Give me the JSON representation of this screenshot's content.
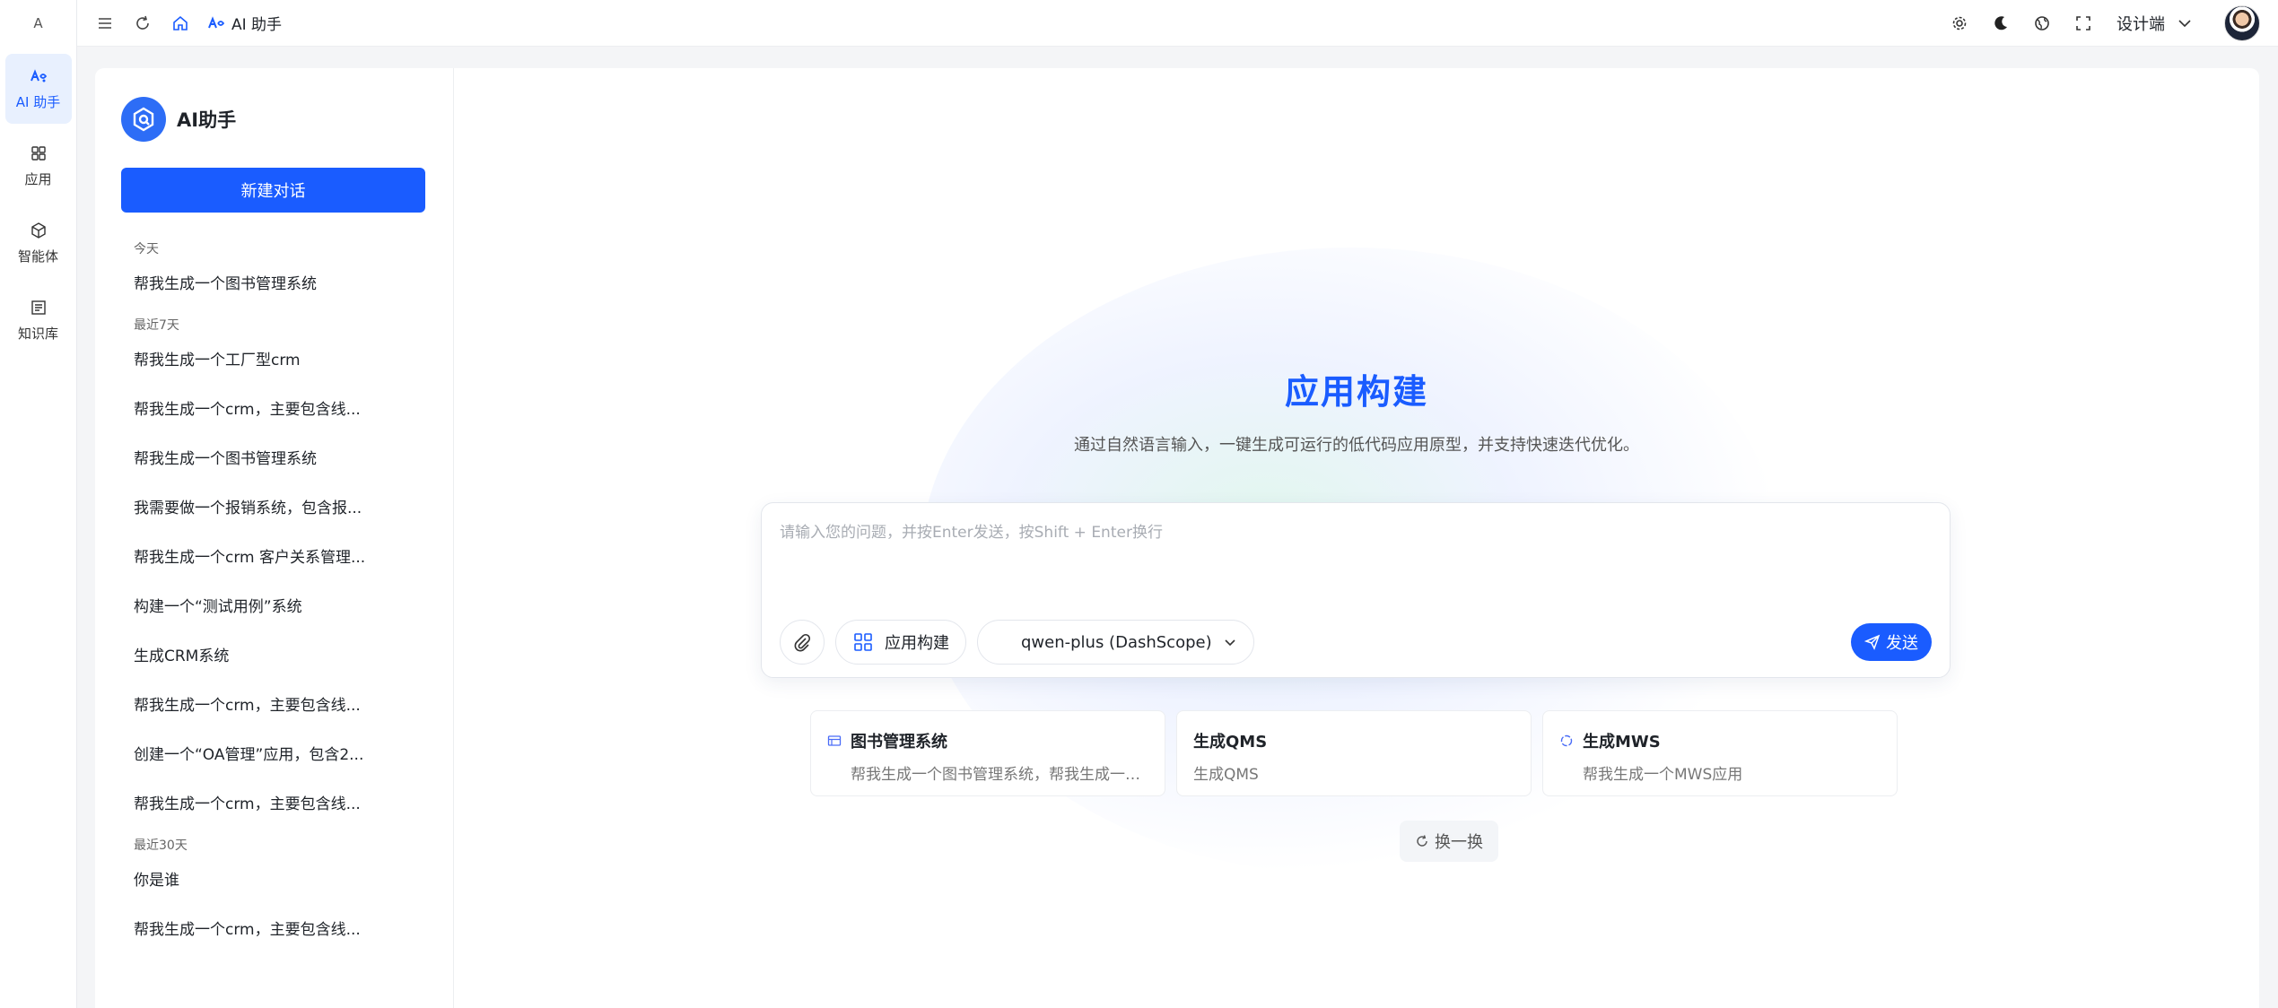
{
  "rail": {
    "logo": "A",
    "items": [
      {
        "label": "AI 助手",
        "icon": "ai-assistant-icon",
        "active": true
      },
      {
        "label": "应用",
        "icon": "apps-grid-icon",
        "active": false
      },
      {
        "label": "智能体",
        "icon": "agent-cube-icon",
        "active": false
      },
      {
        "label": "知识库",
        "icon": "knowledge-base-icon",
        "active": false
      }
    ]
  },
  "topbar": {
    "breadcrumb": "AI 助手",
    "designer_label": "设计端"
  },
  "sidebar": {
    "brand_title": "AI助手",
    "new_chat_label": "新建对话",
    "groups": [
      {
        "title": "今天",
        "items": [
          "帮我生成一个图书管理系统"
        ]
      },
      {
        "title": "最近7天",
        "items": [
          "帮我生成一个工厂型crm",
          "帮我生成一个crm，主要包含线...",
          "帮我生成一个图书管理系统",
          "我需要做一个报销系统，包含报...",
          "帮我生成一个crm 客户关系管理...",
          "构建一个“测试用例”系统",
          "生成CRM系统",
          "帮我生成一个crm，主要包含线...",
          "创建一个“OA管理”应用，包含2...",
          "帮我生成一个crm，主要包含线..."
        ]
      },
      {
        "title": "最近30天",
        "items": [
          "你是谁",
          "帮我生成一个crm，主要包含线..."
        ]
      }
    ]
  },
  "main": {
    "title": "应用构建",
    "subtitle": "通过自然语言输入，一键生成可运行的低代码应用原型，并支持快速迭代优化。",
    "input_placeholder": "请输入您的问题，并按Enter发送，按Shift + Enter换行",
    "mode_label": "应用构建",
    "model_label": "qwen-plus (DashScope)",
    "send_label": "发送",
    "suggestions": [
      {
        "title": "图书管理系统",
        "desc": "帮我生成一个图书管理系统，帮我生成一个图书管理系统",
        "icon": "table-icon"
      },
      {
        "title": "生成QMS",
        "desc": "生成QMS",
        "icon": ""
      },
      {
        "title": "生成MWS",
        "desc": "帮我生成一个MWS应用",
        "icon": "loading-circle-icon"
      }
    ],
    "shuffle_label": "换一换"
  },
  "colors": {
    "accent": "#1a5cff",
    "active_bg": "#e8f0fe"
  }
}
